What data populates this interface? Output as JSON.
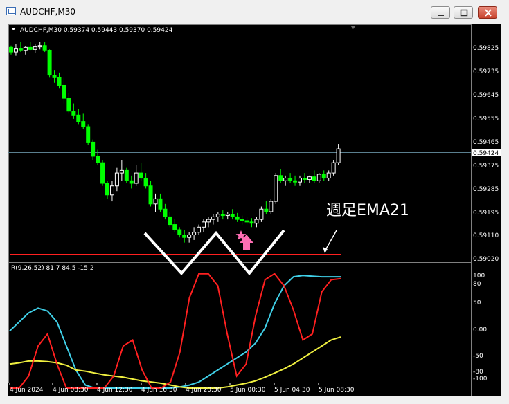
{
  "window": {
    "title": "AUDCHF,M30",
    "buttons": [
      "minimize",
      "maximize",
      "close"
    ]
  },
  "chart_header": {
    "symbol_info": "AUDCHF,M30  0.59374 0.59443 0.59370 0.59424"
  },
  "price_axis": {
    "labels": [
      "0.59825",
      "0.59735",
      "0.59645",
      "0.59555",
      "0.59465",
      "0.59375",
      "0.59285",
      "0.59195",
      "0.59110",
      "0.59020"
    ],
    "current_price": "0.59424"
  },
  "indicator": {
    "label": "R(9,26,52) 81.7 84.5 -15.2",
    "axis_labels": [
      "100",
      "80",
      "50",
      "0.00",
      "-50",
      "-80",
      "-100"
    ]
  },
  "time_axis": {
    "labels": [
      "4 Jun 2024",
      "4 Jun 08:30",
      "4 Jun 12:30",
      "4 Jun 16:30",
      "4 Jun 20:30",
      "5 Jun 00:30",
      "5 Jun 04:30",
      "5 Jun 08:30"
    ]
  },
  "annotation": {
    "text": "週足EMA21"
  },
  "colors": {
    "background": "#000000",
    "candle": "#ffffff",
    "candle_bear": "#00ff00",
    "support_line": "#ff2020",
    "indicator_red": "#ff2020",
    "indicator_cyan": "#40d0e8",
    "indicator_yellow": "#f0f040",
    "arrow": "#ff6eb4"
  },
  "chart_data": {
    "type": "candlestick",
    "symbol": "AUDCHF",
    "timeframe": "M30",
    "candles": [
      [
        0.59818,
        0.59825,
        0.5979,
        0.598
      ],
      [
        0.598,
        0.5983,
        0.59785,
        0.59812
      ],
      [
        0.59812,
        0.5984,
        0.598,
        0.59805
      ],
      [
        0.59805,
        0.59822,
        0.5979,
        0.59818
      ],
      [
        0.59818,
        0.5984,
        0.59805,
        0.5981
      ],
      [
        0.5981,
        0.5983,
        0.59795,
        0.5982
      ],
      [
        0.5982,
        0.5984,
        0.5981,
        0.59825
      ],
      [
        0.59825,
        0.59838,
        0.598,
        0.59805
      ],
      [
        0.59805,
        0.5981,
        0.597,
        0.5971
      ],
      [
        0.5971,
        0.5973,
        0.5968,
        0.597
      ],
      [
        0.597,
        0.5972,
        0.5966,
        0.5967
      ],
      [
        0.5967,
        0.597,
        0.596,
        0.5962
      ],
      [
        0.5962,
        0.5964,
        0.5956,
        0.5957
      ],
      [
        0.5957,
        0.596,
        0.5954,
        0.59555
      ],
      [
        0.59555,
        0.5958,
        0.5952,
        0.5953
      ],
      [
        0.5953,
        0.5956,
        0.595,
        0.5951
      ],
      [
        0.5951,
        0.5952,
        0.5944,
        0.5945
      ],
      [
        0.5945,
        0.5946,
        0.5938,
        0.59395
      ],
      [
        0.59395,
        0.5942,
        0.5936,
        0.5937
      ],
      [
        0.5937,
        0.5938,
        0.5928,
        0.5929
      ],
      [
        0.5929,
        0.593,
        0.5923,
        0.59245
      ],
      [
        0.59245,
        0.593,
        0.5922,
        0.5928
      ],
      [
        0.5928,
        0.5935,
        0.5926,
        0.5933
      ],
      [
        0.5933,
        0.5938,
        0.593,
        0.5934
      ],
      [
        0.5934,
        0.5935,
        0.5929,
        0.593
      ],
      [
        0.593,
        0.5932,
        0.5927,
        0.5929
      ],
      [
        0.5929,
        0.5936,
        0.5928,
        0.5933
      ],
      [
        0.5933,
        0.5937,
        0.593,
        0.5931
      ],
      [
        0.5931,
        0.5933,
        0.5927,
        0.5928
      ],
      [
        0.5928,
        0.593,
        0.592,
        0.5921
      ],
      [
        0.5921,
        0.5925,
        0.5918,
        0.5923
      ],
      [
        0.5923,
        0.5925,
        0.5918,
        0.5919
      ],
      [
        0.5919,
        0.5921,
        0.5915,
        0.5916
      ],
      [
        0.5916,
        0.5918,
        0.5912,
        0.5913
      ],
      [
        0.5913,
        0.5915,
        0.591,
        0.5911
      ],
      [
        0.5911,
        0.5912,
        0.5908,
        0.5909
      ],
      [
        0.5909,
        0.5911,
        0.5906,
        0.5908
      ],
      [
        0.5908,
        0.591,
        0.5906,
        0.5909
      ],
      [
        0.5909,
        0.5912,
        0.5907,
        0.591
      ],
      [
        0.591,
        0.5913,
        0.5909,
        0.5912
      ],
      [
        0.5912,
        0.5915,
        0.591,
        0.5914
      ],
      [
        0.5914,
        0.5916,
        0.5912,
        0.5915
      ],
      [
        0.5915,
        0.5917,
        0.5913,
        0.5916
      ],
      [
        0.5916,
        0.5918,
        0.5914,
        0.5917
      ],
      [
        0.5917,
        0.59185,
        0.5915,
        0.59165
      ],
      [
        0.59165,
        0.5918,
        0.5915,
        0.5917
      ],
      [
        0.5917,
        0.5919,
        0.5915,
        0.5916
      ],
      [
        0.5916,
        0.59175,
        0.5914,
        0.5915
      ],
      [
        0.5915,
        0.59165,
        0.5913,
        0.59145
      ],
      [
        0.59145,
        0.5916,
        0.5913,
        0.5914
      ],
      [
        0.5914,
        0.59155,
        0.5912,
        0.59135
      ],
      [
        0.59135,
        0.5916,
        0.5912,
        0.5915
      ],
      [
        0.5915,
        0.592,
        0.5914,
        0.5919
      ],
      [
        0.5919,
        0.5922,
        0.5917,
        0.5918
      ],
      [
        0.5918,
        0.5923,
        0.5917,
        0.5922
      ],
      [
        0.5922,
        0.5933,
        0.5921,
        0.5932
      ],
      [
        0.5932,
        0.59345,
        0.5929,
        0.593
      ],
      [
        0.593,
        0.5932,
        0.5928,
        0.5931
      ],
      [
        0.5931,
        0.5933,
        0.5929,
        0.593
      ],
      [
        0.593,
        0.5932,
        0.5928,
        0.59295
      ],
      [
        0.59295,
        0.5932,
        0.5928,
        0.5931
      ],
      [
        0.5931,
        0.5933,
        0.5929,
        0.59305
      ],
      [
        0.59305,
        0.5932,
        0.5929,
        0.59315
      ],
      [
        0.59315,
        0.5934,
        0.5929,
        0.593
      ],
      [
        0.593,
        0.5933,
        0.5929,
        0.59325
      ],
      [
        0.59325,
        0.5934,
        0.593,
        0.5931
      ],
      [
        0.5931,
        0.5934,
        0.593,
        0.5933
      ],
      [
        0.5933,
        0.5938,
        0.5932,
        0.5937
      ],
      [
        0.5937,
        0.59443,
        0.5936,
        0.59424
      ]
    ]
  }
}
